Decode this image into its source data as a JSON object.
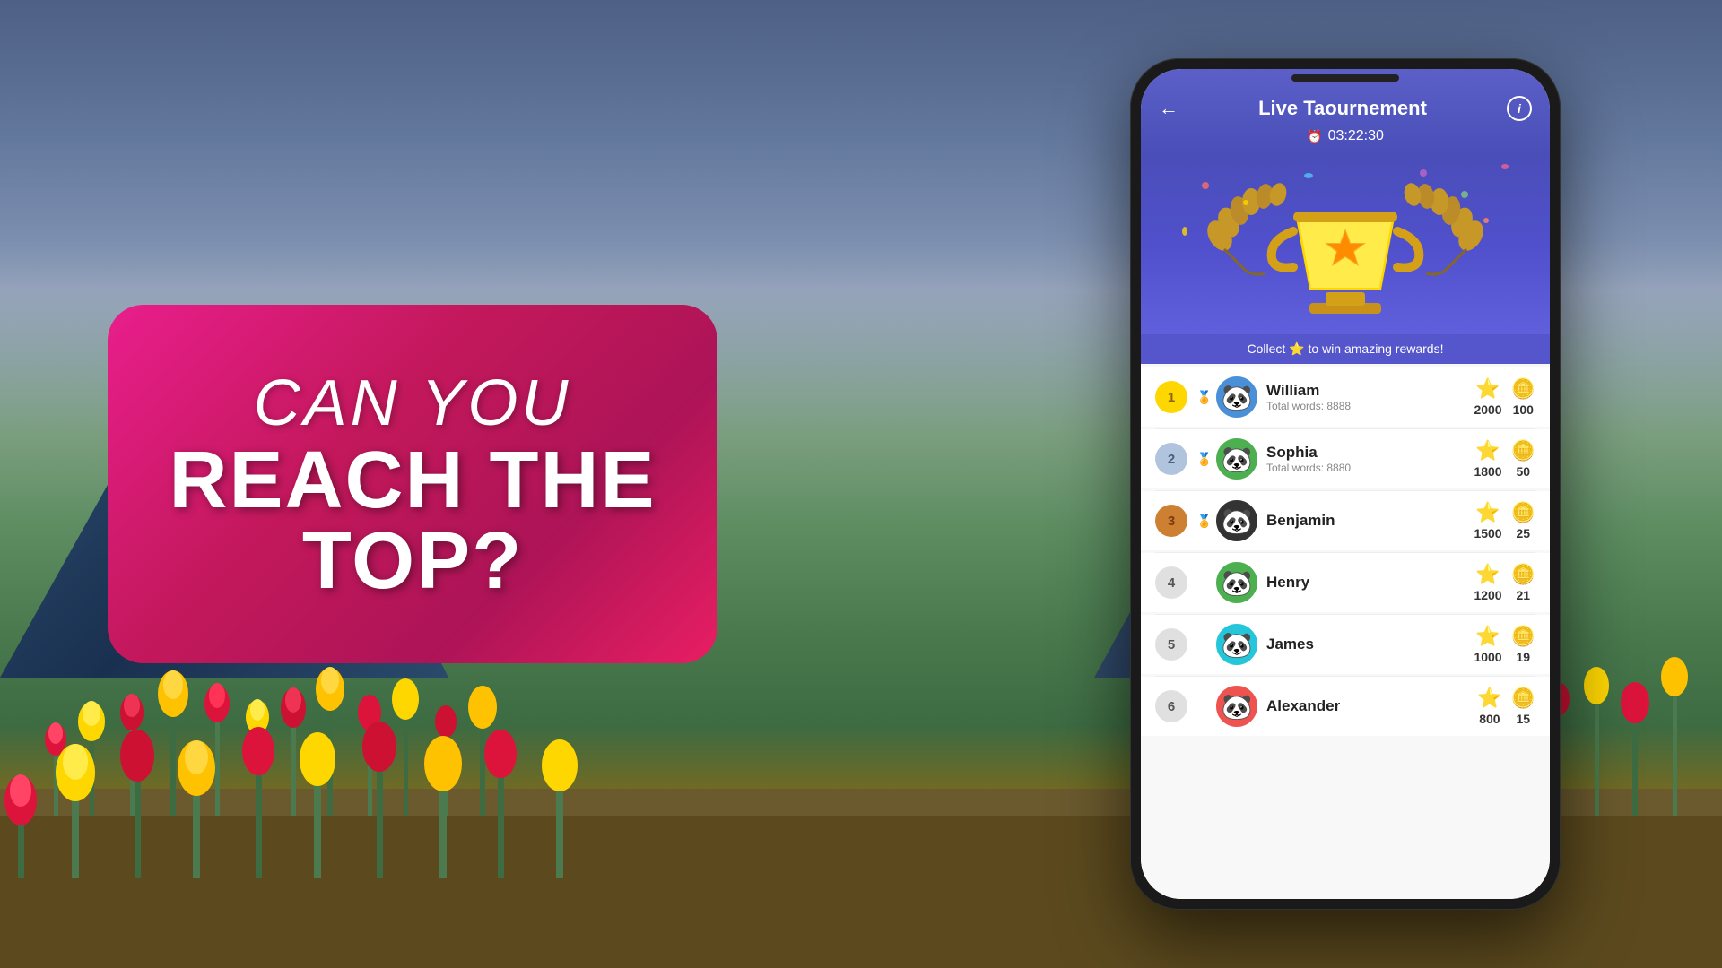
{
  "background": {
    "description": "Tulip field with mountains and cloudy sky"
  },
  "promo": {
    "line1": "CAN YOU",
    "line2": "REACH THE",
    "line3": "TOP?"
  },
  "phone": {
    "header": {
      "title": "Live Taournement",
      "timer": "03:22:30",
      "back_label": "←",
      "info_label": "i"
    },
    "collect_banner": "Collect ⭐ to win amazing rewards!",
    "leaderboard": [
      {
        "rank": 1,
        "rank_class": "rank-1",
        "avatar_class": "avatar-1",
        "name": "William",
        "words": "Total words: 8888",
        "score": 2000,
        "coins": 100,
        "medal": "🥇"
      },
      {
        "rank": 2,
        "rank_class": "rank-2",
        "avatar_class": "avatar-2",
        "name": "Sophia",
        "words": "Total words: 8880",
        "score": 1800,
        "coins": 50,
        "medal": "🥈"
      },
      {
        "rank": 3,
        "rank_class": "rank-3",
        "avatar_class": "avatar-3",
        "name": "Benjamin",
        "words": "",
        "score": 1500,
        "coins": 25,
        "medal": "🥉"
      },
      {
        "rank": 4,
        "rank_class": "rank-4",
        "avatar_class": "avatar-4",
        "name": "Henry",
        "words": "",
        "score": 1200,
        "coins": 21,
        "medal": ""
      },
      {
        "rank": 5,
        "rank_class": "rank-5",
        "avatar_class": "avatar-5",
        "name": "James",
        "words": "",
        "score": 1000,
        "coins": 19,
        "medal": ""
      },
      {
        "rank": 6,
        "rank_class": "rank-6",
        "avatar_class": "avatar-6",
        "name": "Alexander",
        "words": "",
        "score": 800,
        "coins": 15,
        "medal": ""
      }
    ]
  }
}
